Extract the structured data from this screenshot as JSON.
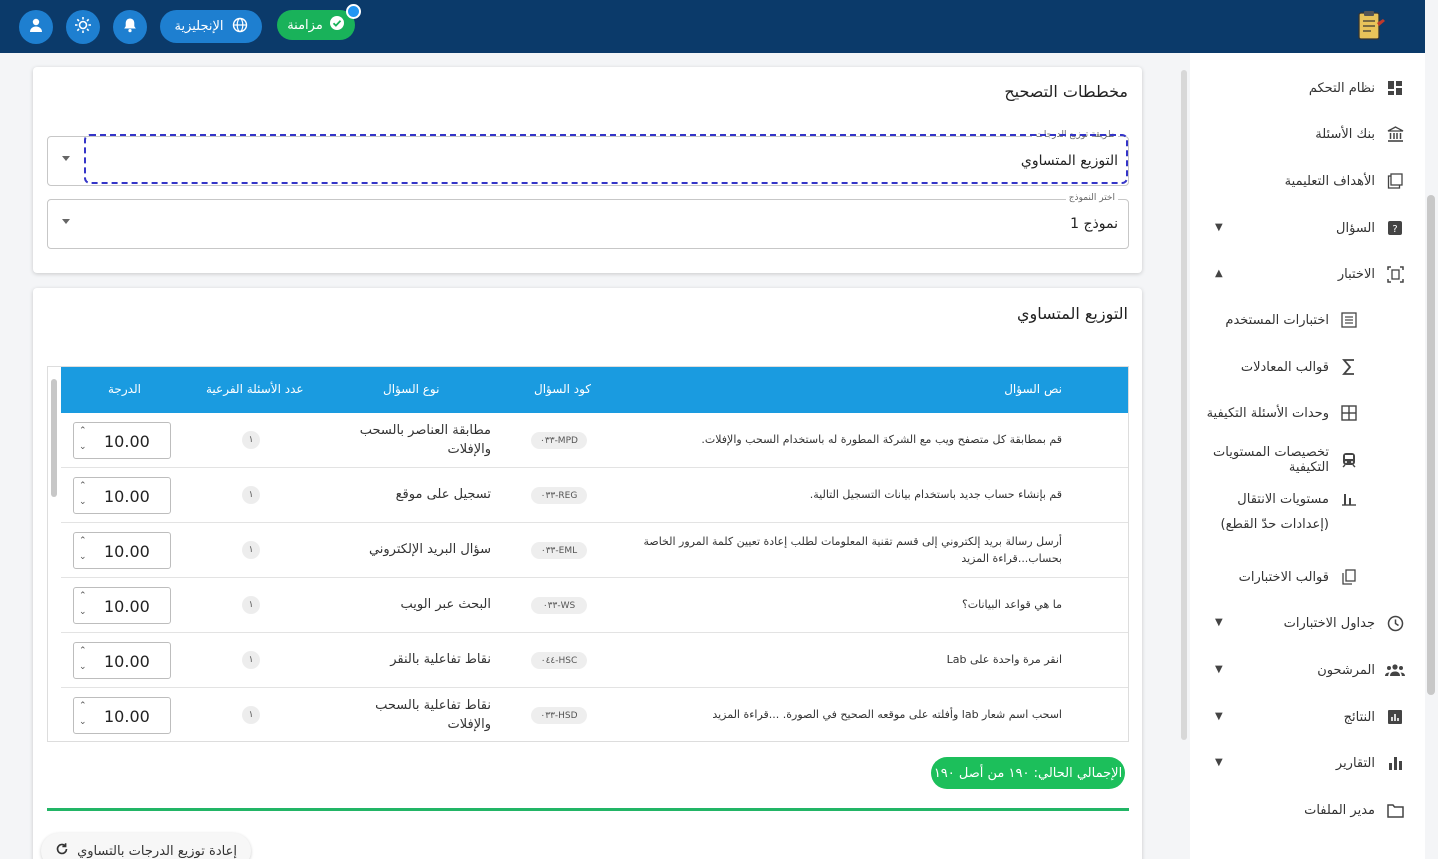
{
  "header": {
    "sync_label": "مزامنة",
    "language_label": "الإنجليزية",
    "icons": [
      "user-icon",
      "brightness-icon",
      "bell-icon",
      "globe-icon",
      "check-icon",
      "app-logo"
    ],
    "colors": {
      "bar": "#0b3a6a",
      "button": "#1e7fd0",
      "sync": "#19b25a"
    }
  },
  "sidebar": {
    "items": [
      {
        "label": "نظام التحكم",
        "icon": "dashboard-icon",
        "caret": ""
      },
      {
        "label": "بنك الأسئلة",
        "icon": "bank-icon",
        "caret": ""
      },
      {
        "label": "الأهداف التعليمية",
        "icon": "book-icon",
        "caret": ""
      },
      {
        "label": "السؤال",
        "icon": "question-icon",
        "caret": "down"
      },
      {
        "label": "الاختبار",
        "icon": "exam-icon",
        "caret": "up"
      },
      {
        "label": "اختبارات المستخدم",
        "icon": "list-icon",
        "caret": "",
        "sub": true
      },
      {
        "label": "قوالب المعادلات",
        "icon": "sigma-icon",
        "caret": "",
        "sub": true
      },
      {
        "label": "وحدات الأسئلة التكيفية",
        "icon": "grid-icon",
        "caret": "",
        "sub": true
      },
      {
        "label": "تخصيصات المستويات التكيفية",
        "icon": "train-icon",
        "caret": "",
        "sub": true
      },
      {
        "label": "مستويات الانتقال (إعدادات حدّ القطع)",
        "icon": "bar-icon",
        "caret": "",
        "sub": true
      },
      {
        "label": "قوالب الاختبارات",
        "icon": "copy-icon",
        "caret": "",
        "sub": true
      },
      {
        "label": "جداول الاختبارات",
        "icon": "clock-icon",
        "caret": "down"
      },
      {
        "label": "المرشحون",
        "icon": "people-icon",
        "caret": "down"
      },
      {
        "label": "النتائج",
        "icon": "results-icon",
        "caret": "down"
      },
      {
        "label": "التقارير",
        "icon": "chart-icon",
        "caret": "down"
      },
      {
        "label": "مدير الملفات",
        "icon": "folder-icon",
        "caret": ""
      }
    ]
  },
  "plan_card": {
    "title": "مخططات التصحيح",
    "distribution_label": "طريقة توزيع الدرجات",
    "distribution_value": "التوزيع المتساوي",
    "model_label": "اختر النموذج",
    "model_value": "نموذج 1"
  },
  "table_card": {
    "title": "التوزيع المتساوي",
    "columns": {
      "text": "نص السؤال",
      "code": "كود السؤال",
      "type": "نوع السؤال",
      "subq": "عدد الأسئلة الفرعية",
      "score": "الدرجة"
    },
    "rows": [
      {
        "text": "قم بمطابقة كل متصفح ويب مع الشركة المطورة له باستخدام السحب والإفلات.",
        "code": "٠٣٣-MPD",
        "type": "مطابقة العناصر بالسحب والإفلات",
        "subq": "١",
        "score": "10.00"
      },
      {
        "text": "قم بإنشاء حساب جديد باستخدام بيانات التسجيل التالية.",
        "code": "٠٣٣-REG",
        "type": "تسجيل على موقع",
        "subq": "١",
        "score": "10.00"
      },
      {
        "text": "أرسل رسالة بريد إلكتروني إلى قسم تقنية المعلومات لطلب إعادة تعيين كلمة المرور الخاصة بحساب...قراءة المزيد",
        "code": "٠٣٣-EML",
        "type": "سؤال البريد الإلكتروني",
        "subq": "١",
        "score": "10.00"
      },
      {
        "text": "ما هي قواعد البيانات؟",
        "code": "٠٣٣-WS",
        "type": "البحث عبر الويب",
        "subq": "١",
        "score": "10.00"
      },
      {
        "text": "انقر مرة واحدة على Lab",
        "code": "٠٤٤-HSC",
        "type": "نقاط تفاعلية بالنقر",
        "subq": "١",
        "score": "10.00"
      },
      {
        "text": "اسحب اسم شعار lab وأفلته على موقعه الصحيح في الصورة. ...قراءة المزيد",
        "code": "٠٣٣-HSD",
        "type": "نقاط تفاعلية بالسحب والإفلات",
        "subq": "١",
        "score": "10.00"
      }
    ],
    "total_label": "الإجمالي الحالي: ١٩٠ من أصل ١٩٠",
    "reset_label": "إعادة توزيع الدرجات بالتساوي"
  }
}
